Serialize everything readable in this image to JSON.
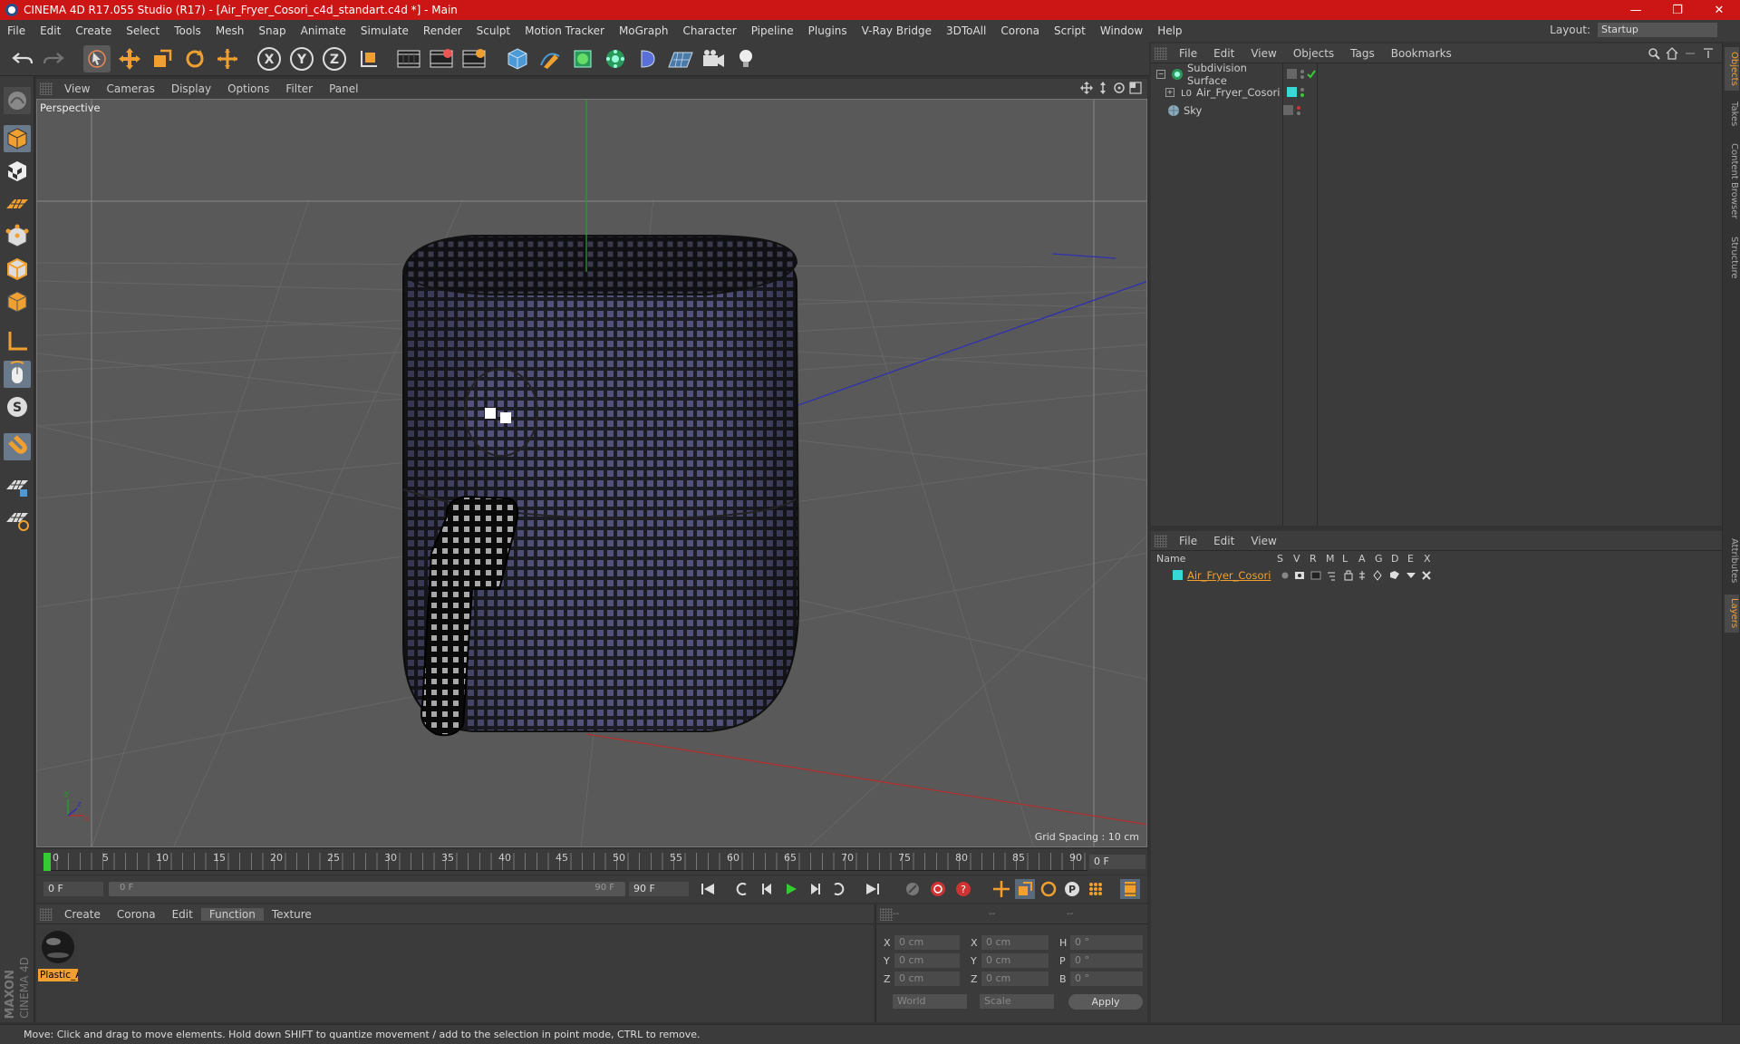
{
  "window": {
    "title": "CINEMA 4D R17.055 Studio (R17) - [Air_Fryer_Cosori_c4d_standart.c4d *] - Main",
    "minimize": "—",
    "restore": "❐",
    "close": "✕"
  },
  "menu": [
    "File",
    "Edit",
    "Create",
    "Select",
    "Tools",
    "Mesh",
    "Snap",
    "Animate",
    "Simulate",
    "Render",
    "Sculpt",
    "Motion Tracker",
    "MoGraph",
    "Character",
    "Pipeline",
    "Plugins",
    "V-Ray Bridge",
    "3DToAll",
    "Corona",
    "Script",
    "Window",
    "Help"
  ],
  "layout": {
    "label": "Layout:",
    "value": "Startup"
  },
  "toolbar": {
    "x": "X",
    "y": "Y",
    "z": "Z"
  },
  "viewport": {
    "menu": [
      "View",
      "Cameras",
      "Display",
      "Options",
      "Filter",
      "Panel"
    ],
    "label": "Perspective",
    "grid_spacing": "Grid Spacing : 10 cm",
    "axis_y": "y",
    "axis_x": "x",
    "axis_z": "z"
  },
  "timeline": {
    "ticks": [
      "0",
      "5",
      "10",
      "15",
      "20",
      "25",
      "30",
      "35",
      "40",
      "45",
      "50",
      "55",
      "60",
      "65",
      "70",
      "75",
      "80",
      "85",
      "90"
    ],
    "current_frame": "0 F"
  },
  "playbar": {
    "start": "0 F",
    "slider_start": "0 F",
    "slider_end": "90 F",
    "end": "90 F"
  },
  "material_manager": {
    "menu": [
      "Create",
      "Corona",
      "Edit",
      "Function",
      "Texture"
    ],
    "active_menu": "Function",
    "material_name": "Plastic_A"
  },
  "coordinates": {
    "headers": [
      "--",
      "--",
      "--"
    ],
    "rows": [
      {
        "l1": "X",
        "v1": "0 cm",
        "l2": "X",
        "v2": "0 cm",
        "l3": "H",
        "v3": "0 °"
      },
      {
        "l1": "Y",
        "v1": "0 cm",
        "l2": "Y",
        "v2": "0 cm",
        "l3": "P",
        "v3": "0 °"
      },
      {
        "l1": "Z",
        "v1": "0 cm",
        "l2": "Z",
        "v2": "0 cm",
        "l3": "B",
        "v3": "0 °"
      }
    ],
    "mode": "World",
    "transform": "Scale",
    "apply": "Apply"
  },
  "object_manager": {
    "menu": [
      "File",
      "Edit",
      "View",
      "Objects",
      "Tags",
      "Bookmarks"
    ],
    "objects": [
      {
        "name": "Subdivision Surface",
        "color": "#3ea"
      },
      {
        "name": "Air_Fryer_Cosori",
        "color": "#37d8d8"
      },
      {
        "name": "Sky",
        "color": "#7aa"
      }
    ]
  },
  "layer_manager": {
    "menu": [
      "File",
      "Edit",
      "View"
    ],
    "columns": [
      "Name",
      "S",
      "V",
      "R",
      "M",
      "L",
      "A",
      "G",
      "D",
      "E",
      "X"
    ],
    "layers": [
      {
        "name": "Air_Fryer_Cosori",
        "color": "#37d8d8"
      }
    ]
  },
  "right_tabs": [
    "Objects",
    "Takes",
    "Content Browser",
    "Structure",
    "Attributes",
    "Layers"
  ],
  "brand": {
    "line1": "MAXON",
    "line2": "CINEMA 4D"
  },
  "status": "Move: Click and drag to move elements. Hold down SHIFT to quantize movement / add to the selection in point mode, CTRL to remove.",
  "colors": {
    "accent": "#f0a030",
    "title_bar": "#cc1515",
    "panel": "#3b3b3b",
    "viewport": "#595959"
  }
}
